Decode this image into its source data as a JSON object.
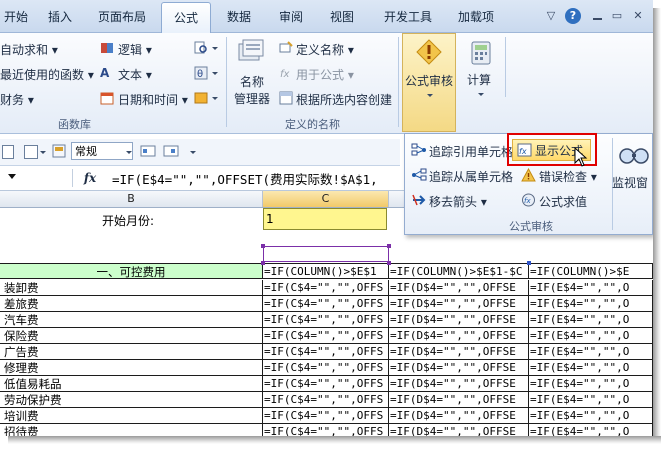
{
  "tabs": [
    {
      "label": "开始",
      "active": false
    },
    {
      "label": "插入",
      "active": false
    },
    {
      "label": "页面布局",
      "active": false
    },
    {
      "label": "公式",
      "active": true
    },
    {
      "label": "数据",
      "active": false
    },
    {
      "label": "审阅",
      "active": false
    },
    {
      "label": "视图",
      "active": false
    },
    {
      "label": "开发工具",
      "active": false
    },
    {
      "label": "加载项",
      "active": false
    }
  ],
  "window_controls": {
    "help": "?",
    "minimize": "▽",
    "restore": "▭",
    "close": "✕"
  },
  "ribbon": {
    "function_library": {
      "autosum": "自动求和",
      "recent": "最近使用的函数",
      "financial": "财务",
      "logical": "逻辑",
      "text": "文本",
      "datetime": "日期和时间",
      "group_label": "函数库"
    },
    "defined_names": {
      "name_manager_line1": "名称",
      "name_manager_line2": "管理器",
      "define_name": "定义名称",
      "use_in_formula": "用于公式",
      "create_from_selection": "根据所选内容创建",
      "group_label": "定义的名称"
    },
    "formula_auditing_btn": "公式审核",
    "calculation_btn": "计算"
  },
  "auditing_panel": {
    "trace_precedents": "追踪引用单元格",
    "trace_dependents": "追踪从属单元格",
    "remove_arrows": "移去箭头",
    "show_formulas": "显示公式",
    "error_checking": "错误检查",
    "evaluate_formula": "公式求值",
    "group_label": "公式审核",
    "watch_window": "监视窗"
  },
  "toolbar": {
    "style_combo": "常规"
  },
  "formula_bar": {
    "fx": "fx",
    "formula": "=IF(E$4=\"\",\"\",OFFSET(费用实际数!$A$1,"
  },
  "columns": [
    "B",
    "C"
  ],
  "sheet": {
    "start_month_label": "开始月份:",
    "start_month_value": "1",
    "section_header": "一、可控费用",
    "header_formula_1": "=IF(COLUMN()>$E$1",
    "header_formula_2": "=IF(COLUMN()>$E$1-$C",
    "header_formula_3": "=IF(COLUMN()>$E",
    "items": [
      "装卸费",
      "差旅费",
      "汽车费",
      "保险费",
      "广告费",
      "修理费",
      "低值易耗品",
      "劳动保护费",
      "培训费",
      "招待费"
    ],
    "row_formula_c": "=IF(C$4=\"\",\"\",OFFS",
    "row_formula_d": "=IF(D$4=\"\",\"\",OFFSE",
    "row_formula_e": "=IF(E$4=\"\",\"\",O"
  },
  "colors": {
    "accent": "#1f5aa8",
    "selection_fill": "#fff68f",
    "section_fill": "#ccffcc",
    "highlight_border": "#e00000"
  }
}
